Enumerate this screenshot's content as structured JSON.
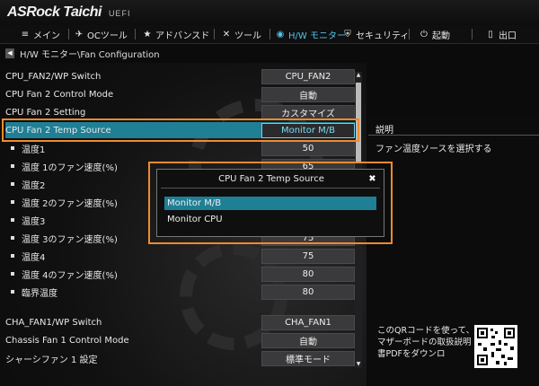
{
  "brand": {
    "logo": "ASRock Taichi",
    "uefi": "UEFI"
  },
  "nav": {
    "items": [
      {
        "icon": "≡",
        "label": "メイン",
        "active": false
      },
      {
        "icon": "✈",
        "label": "OCツール",
        "active": false
      },
      {
        "icon": "★",
        "label": "アドバンスド",
        "active": false
      },
      {
        "icon": "✕",
        "label": "ツール",
        "active": false
      },
      {
        "icon": "◉",
        "label": "H/W モニター",
        "active": true
      },
      {
        "icon": "⛨",
        "label": "セキュリティ",
        "active": false
      },
      {
        "icon": "⏻",
        "label": "起動",
        "active": false
      },
      {
        "icon": "▯",
        "label": "出口",
        "active": false
      }
    ]
  },
  "breadcrumb": "H/W モニター\\Fan Configuration",
  "rows": [
    {
      "label": "CPU_FAN2/WP Switch",
      "value": "CPU_FAN2",
      "indent": false,
      "bullet": false
    },
    {
      "label": "CPU Fan 2 Control Mode",
      "value": "自動",
      "indent": false,
      "bullet": false
    },
    {
      "label": "CPU Fan 2 Setting",
      "value": "カスタマイズ",
      "indent": false,
      "bullet": false
    },
    {
      "label": "CPU Fan 2 Temp Source",
      "value": "Monitor M/B",
      "indent": false,
      "bullet": false,
      "selected": true
    },
    {
      "label": "温度1",
      "value": "50",
      "indent": false,
      "bullet": true
    },
    {
      "label": "温度 1のファン速度(%)",
      "value": "65",
      "indent": false,
      "bullet": true
    },
    {
      "label": "温度2",
      "value": "",
      "indent": false,
      "bullet": true
    },
    {
      "label": "温度 2のファン速度(%)",
      "value": "",
      "indent": false,
      "bullet": true
    },
    {
      "label": "温度3",
      "value": "",
      "indent": false,
      "bullet": true
    },
    {
      "label": "温度 3のファン速度(%)",
      "value": "75",
      "indent": false,
      "bullet": true
    },
    {
      "label": "温度4",
      "value": "75",
      "indent": false,
      "bullet": true
    },
    {
      "label": "温度 4のファン速度(%)",
      "value": "80",
      "indent": false,
      "bullet": true
    },
    {
      "label": "臨界温度",
      "value": "80",
      "indent": false,
      "bullet": true
    },
    {
      "label": "CHA_FAN1/WP Switch",
      "value": "CHA_FAN1",
      "indent": false,
      "bullet": false
    },
    {
      "label": "Chassis Fan 1 Control Mode",
      "value": "自動",
      "indent": false,
      "bullet": false
    },
    {
      "label": "シャーシファン 1 設定",
      "value": "標準モード",
      "indent": false,
      "bullet": false
    }
  ],
  "description": {
    "title": "説明",
    "text": "ファン温度ソースを選択する"
  },
  "qr": {
    "text": "このQRコードを使って、マザーボードの取扱説明書PDFをダウンロ"
  },
  "popup": {
    "title": "CPU Fan 2 Temp Source",
    "close": "✖",
    "options": [
      {
        "label": "Monitor M/B",
        "selected": true
      },
      {
        "label": "Monitor CPU",
        "selected": false
      }
    ]
  },
  "colors": {
    "accent": "#4fc3e8",
    "highlight": "#f28a2e",
    "selection": "#1f7f95"
  }
}
